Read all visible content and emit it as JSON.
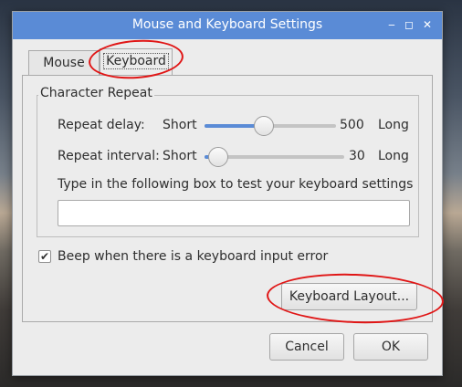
{
  "window": {
    "title": "Mouse and Keyboard Settings",
    "controls": {
      "minimize": "‒",
      "maximize": "◻",
      "close": "✕"
    }
  },
  "tabs": [
    {
      "label": "Mouse",
      "active": false
    },
    {
      "label": "Keyboard",
      "active": true
    }
  ],
  "character_repeat": {
    "frame_label": "Character Repeat",
    "repeat_delay": {
      "label": "Repeat delay:",
      "min_label": "Short",
      "max_label": "Long",
      "value": "500",
      "level": 0.45
    },
    "repeat_interval": {
      "label": "Repeat interval:",
      "min_label": "Short",
      "max_label": "Long",
      "value": "30",
      "level": 0.1
    },
    "test_prompt": "Type in the following box to test your keyboard settings",
    "test_input_value": ""
  },
  "beep": {
    "label": "Beep when there is a keyboard input error",
    "checked": true
  },
  "buttons": {
    "keyboard_layout": "Keyboard Layout...",
    "cancel": "Cancel",
    "ok": "OK"
  },
  "colors": {
    "titlebar": "#5a8bd6",
    "slider_fill": "#5a8bd6",
    "annotation": "#e01616"
  }
}
